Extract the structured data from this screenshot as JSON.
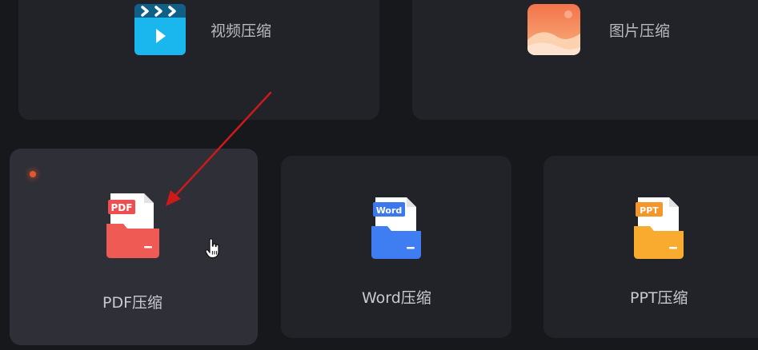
{
  "cards": {
    "video": {
      "label": "视频压缩",
      "icon": "video-play-icon",
      "color": "#1ab6ef"
    },
    "image": {
      "label": "图片压缩",
      "icon": "image-landscape-icon",
      "color": "#f48a5a"
    },
    "pdf": {
      "label": "PDF压缩",
      "badge": "PDF",
      "icon": "pdf-folder-icon",
      "color": "#ee5150",
      "selected": true
    },
    "word": {
      "label": "Word压缩",
      "badge": "Word",
      "icon": "word-folder-icon",
      "color": "#3d7cf2"
    },
    "ppt": {
      "label": "PPT压缩",
      "badge": "PPT",
      "icon": "ppt-folder-icon",
      "color": "#f7a52a"
    }
  },
  "annotation": {
    "arrow_color": "#cc1a1a"
  }
}
